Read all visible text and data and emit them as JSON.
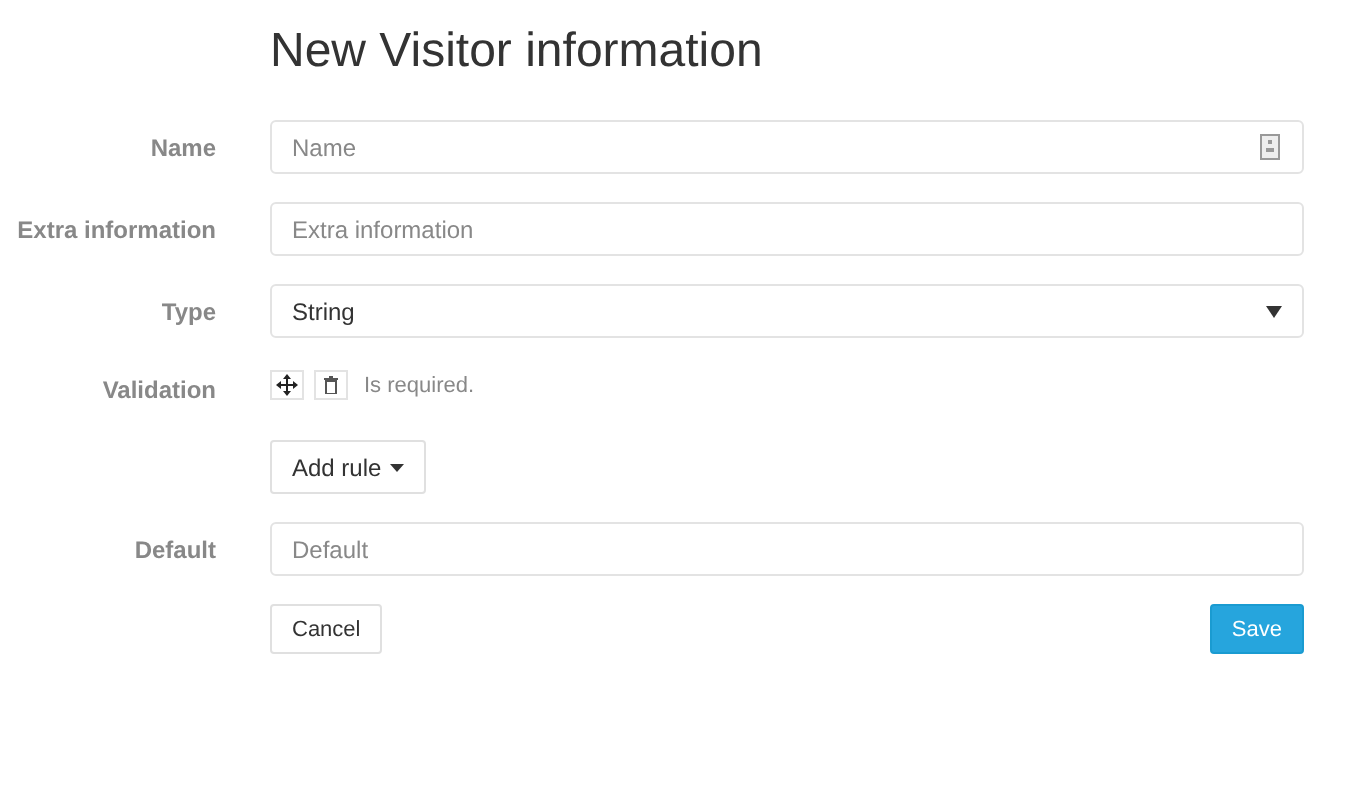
{
  "title": "New Visitor information",
  "fields": [
    {
      "kind": "text",
      "label": "Name",
      "placeholder": "Name",
      "icon": true
    },
    {
      "kind": "text",
      "label": "Extra information",
      "placeholder": "Extra information"
    },
    {
      "kind": "select",
      "label": "Type",
      "value": "String"
    },
    {
      "kind": "rules",
      "label": "Validation",
      "rules": [
        "Is required."
      ],
      "add_button": "Add rule"
    },
    {
      "kind": "text",
      "label": "Default",
      "placeholder": "Default"
    }
  ],
  "buttons": {
    "cancel": "Cancel",
    "save": "Save"
  }
}
